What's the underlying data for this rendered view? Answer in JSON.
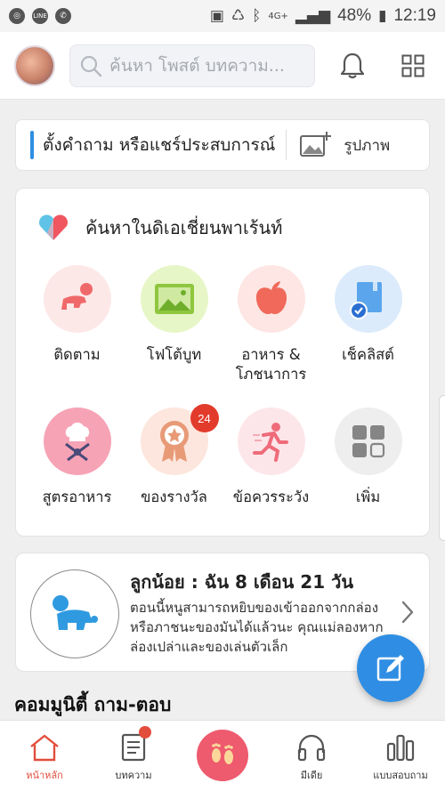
{
  "status_bar": {
    "network_type": "4G+",
    "battery_pct": "48%",
    "time": "12:19",
    "left_icons": [
      "instagram-icon",
      "line-icon",
      "phone-icon"
    ]
  },
  "header": {
    "search_placeholder": "ค้นหา โพสต์ บทความ..."
  },
  "ask": {
    "prompt": "ตั้งคำถาม หรือแชร์ประสบการณ์",
    "photo_label": "รูปภาพ"
  },
  "explore": {
    "title": "ค้นหาในดิเอเชี่ยนพาเร้นท์",
    "items": [
      {
        "label": "ติดตาม",
        "icon": "crawling-baby-icon"
      },
      {
        "label": "โฟโต้บูท",
        "icon": "photo-icon"
      },
      {
        "label": "อาหาร &\nโภชนาการ",
        "icon": "apple-icon"
      },
      {
        "label": "เช็คลิสต์",
        "icon": "checklist-icon"
      },
      {
        "label": "สูตรอาหาร",
        "icon": "chef-icon"
      },
      {
        "label": "ของรางวัล",
        "icon": "award-icon",
        "badge": "24"
      },
      {
        "label": "ข้อควรระวัง",
        "icon": "running-person-icon"
      },
      {
        "label": "เพิ่ม",
        "icon": "more-grid-icon"
      }
    ]
  },
  "baby": {
    "title": "ลูกน้อย : ฉัน 8 เดือน 21 วัน",
    "description": "ตอนนี้หนูสามารถหยิบของเข้าออกจากกล่องหรือภาชนะของมันได้แล้วนะ คุณแม่ลองหากล่องเปล่าและของเล่นตัวเล็ก"
  },
  "community": {
    "title": "คอมมูนิตี้ ถาม-ตอบ"
  },
  "bottom_nav": [
    {
      "label": "หน้าหลัก",
      "icon": "home-icon",
      "active": true
    },
    {
      "label": "บทความ",
      "icon": "article-icon",
      "dot": true
    },
    {
      "label": "",
      "icon": "footprints-icon"
    },
    {
      "label": "มีเดีย",
      "icon": "headphones-icon"
    },
    {
      "label": "แบบสอบถาม",
      "icon": "poll-icon"
    }
  ],
  "colors": {
    "accent_blue": "#2f8ee3",
    "accent_red": "#e24d3c",
    "footprint_pink": "#ee5a6e"
  }
}
